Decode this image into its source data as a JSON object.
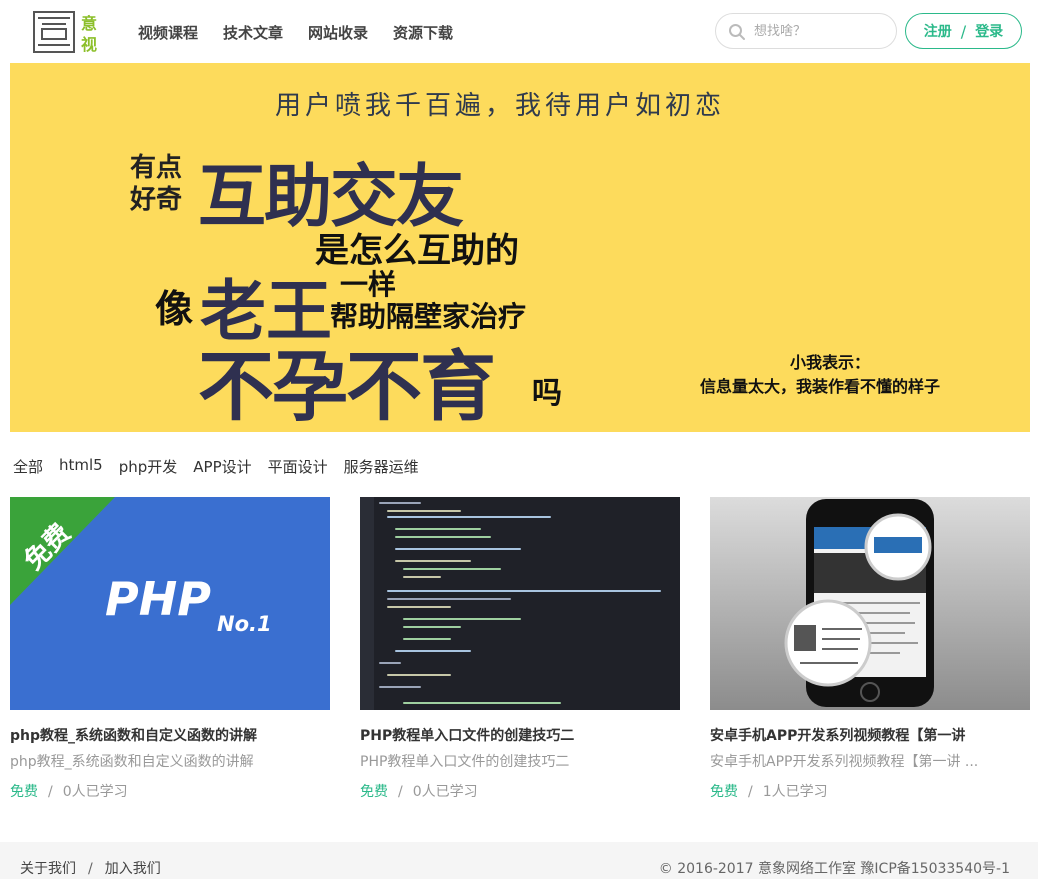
{
  "header": {
    "logo_text_1": "意",
    "logo_text_2": "视",
    "nav": [
      "视频课程",
      "技术文章",
      "网站收录",
      "资源下载"
    ],
    "search_placeholder": "想找啥？",
    "register_label": "注册",
    "login_label": "登录",
    "auth_separator": "/"
  },
  "banner": {
    "line_top": "用户喷我千百遍，我待用户如初恋",
    "small_1": "有点",
    "small_2": "好奇",
    "huge_1": "互助交友",
    "mid_1": "是怎么互助的",
    "prefix_2": "像",
    "huge_2": "老王",
    "mid_2a": "一样",
    "mid_2b": "帮助隔壁家治疗",
    "huge_3": "不孕不育",
    "suffix_3": "吗",
    "aside_1": "小我表示：",
    "aside_2": "信息量太大，我装作看不懂的样子"
  },
  "categories": [
    "全部",
    "html5",
    "php开发",
    "APP设计",
    "平面设计",
    "服务器运维"
  ],
  "cards": [
    {
      "title": "php教程_系统函数和自定义函数的讲解",
      "desc": "php教程_系统函数和自定义函数的讲解",
      "price": "免费",
      "learners": "0人已学习",
      "thumb_badge": "免费",
      "thumb_text": "PHP",
      "thumb_sub": "No.1"
    },
    {
      "title": "PHP教程单入口文件的创建技巧二",
      "desc": "PHP教程单入口文件的创建技巧二",
      "price": "免费",
      "learners": "0人已学习"
    },
    {
      "title": "安卓手机APP开发系列视频教程【第一讲",
      "desc": "安卓手机APP开发系列视频教程【第一讲 ...",
      "price": "免费",
      "learners": "1人已学习"
    }
  ],
  "footer": {
    "about": "关于我们",
    "join": "加入我们",
    "separator": "/",
    "copyright": "© 2016-2017 意象网络工作室 豫ICP备15033540号-1"
  },
  "colors": {
    "accent": "#2bb98a",
    "banner_bg": "#fddb5c",
    "php_bg": "#3a6fd0",
    "ribbon": "#3aa33a"
  }
}
